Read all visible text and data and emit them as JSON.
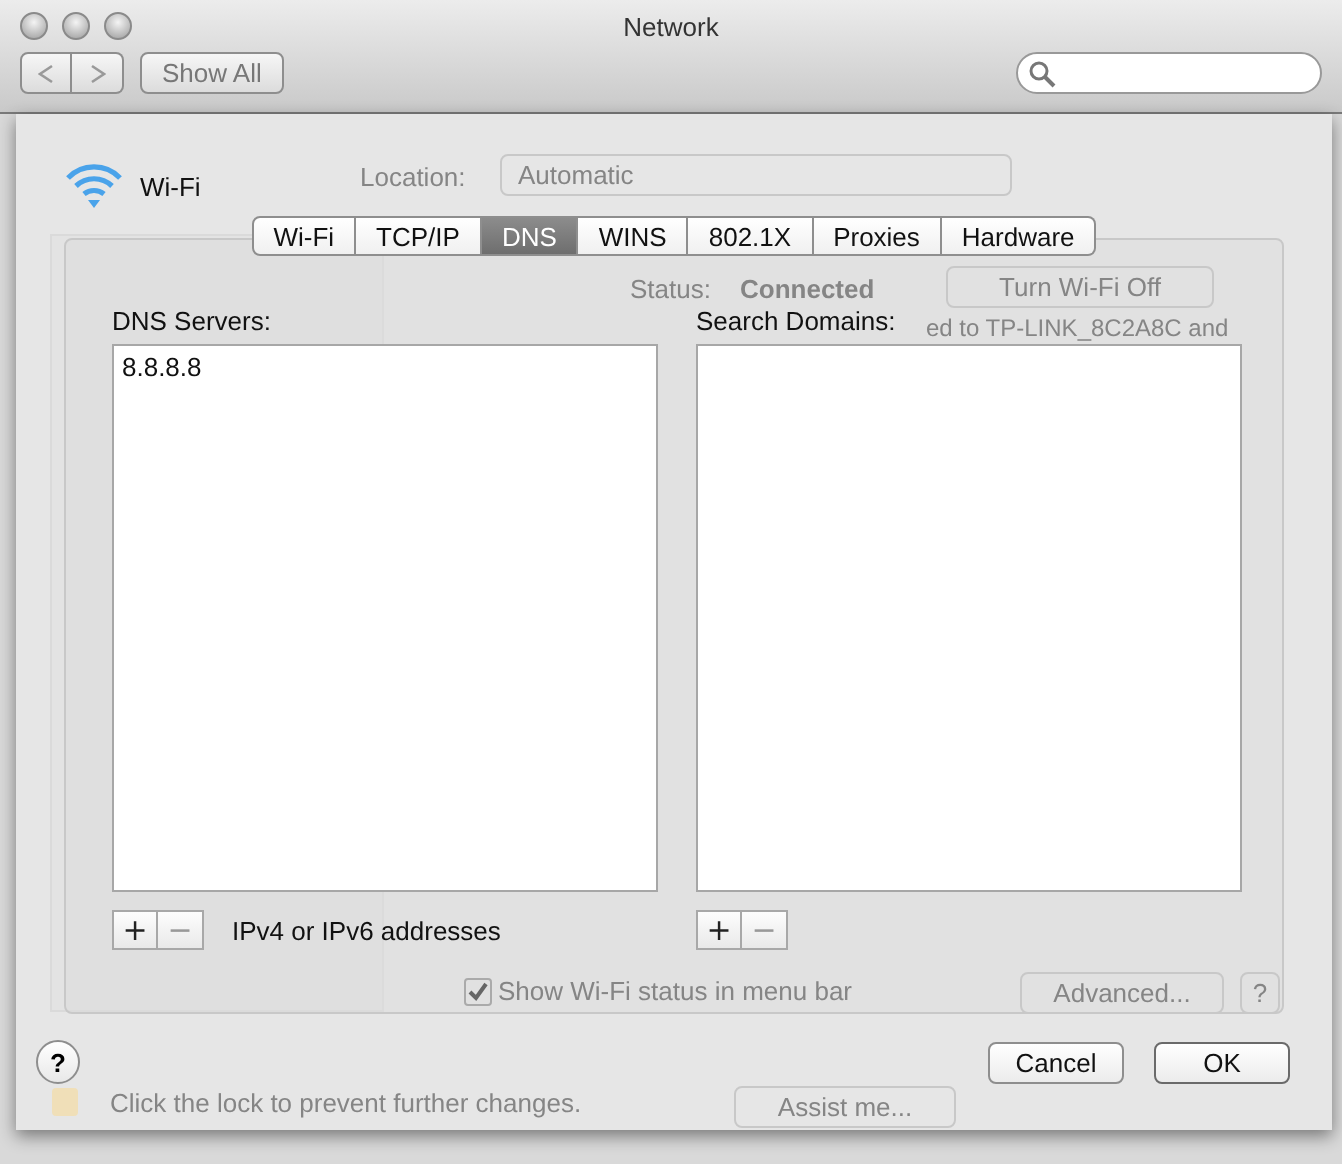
{
  "window": {
    "title": "Network",
    "show_all": "Show All"
  },
  "background": {
    "location_label": "Location:",
    "location_value": "Automatic",
    "status_label": "Status:",
    "status_value": "Connected",
    "turn_off_button": "Turn Wi-Fi Off",
    "status_note": "ed to TP-LINK_8C2A8C and",
    "menu_bar_checkbox": {
      "label": "Show Wi-Fi status in menu bar",
      "checked": true
    },
    "advanced_button": "Advanced...",
    "help": "?",
    "lock_note": "Click the lock to prevent further changes.",
    "assist_button": "Assist me..."
  },
  "sheet": {
    "service": "Wi-Fi",
    "tabs": [
      {
        "label": "Wi-Fi",
        "selected": false
      },
      {
        "label": "TCP/IP",
        "selected": false
      },
      {
        "label": "DNS",
        "selected": true
      },
      {
        "label": "WINS",
        "selected": false
      },
      {
        "label": "802.1X",
        "selected": false
      },
      {
        "label": "Proxies",
        "selected": false
      },
      {
        "label": "Hardware",
        "selected": false
      }
    ],
    "dns_servers": {
      "label": "DNS Servers:",
      "items": [
        "8.8.8.8"
      ],
      "add": "+",
      "remove": "−",
      "hint": "IPv4 or IPv6 addresses"
    },
    "search_domains": {
      "label": "Search Domains:",
      "add": "+",
      "remove": "−"
    },
    "help": "?",
    "buttons": [
      {
        "label": "Cancel",
        "default": false
      },
      {
        "label": "OK",
        "default": true
      }
    ]
  }
}
